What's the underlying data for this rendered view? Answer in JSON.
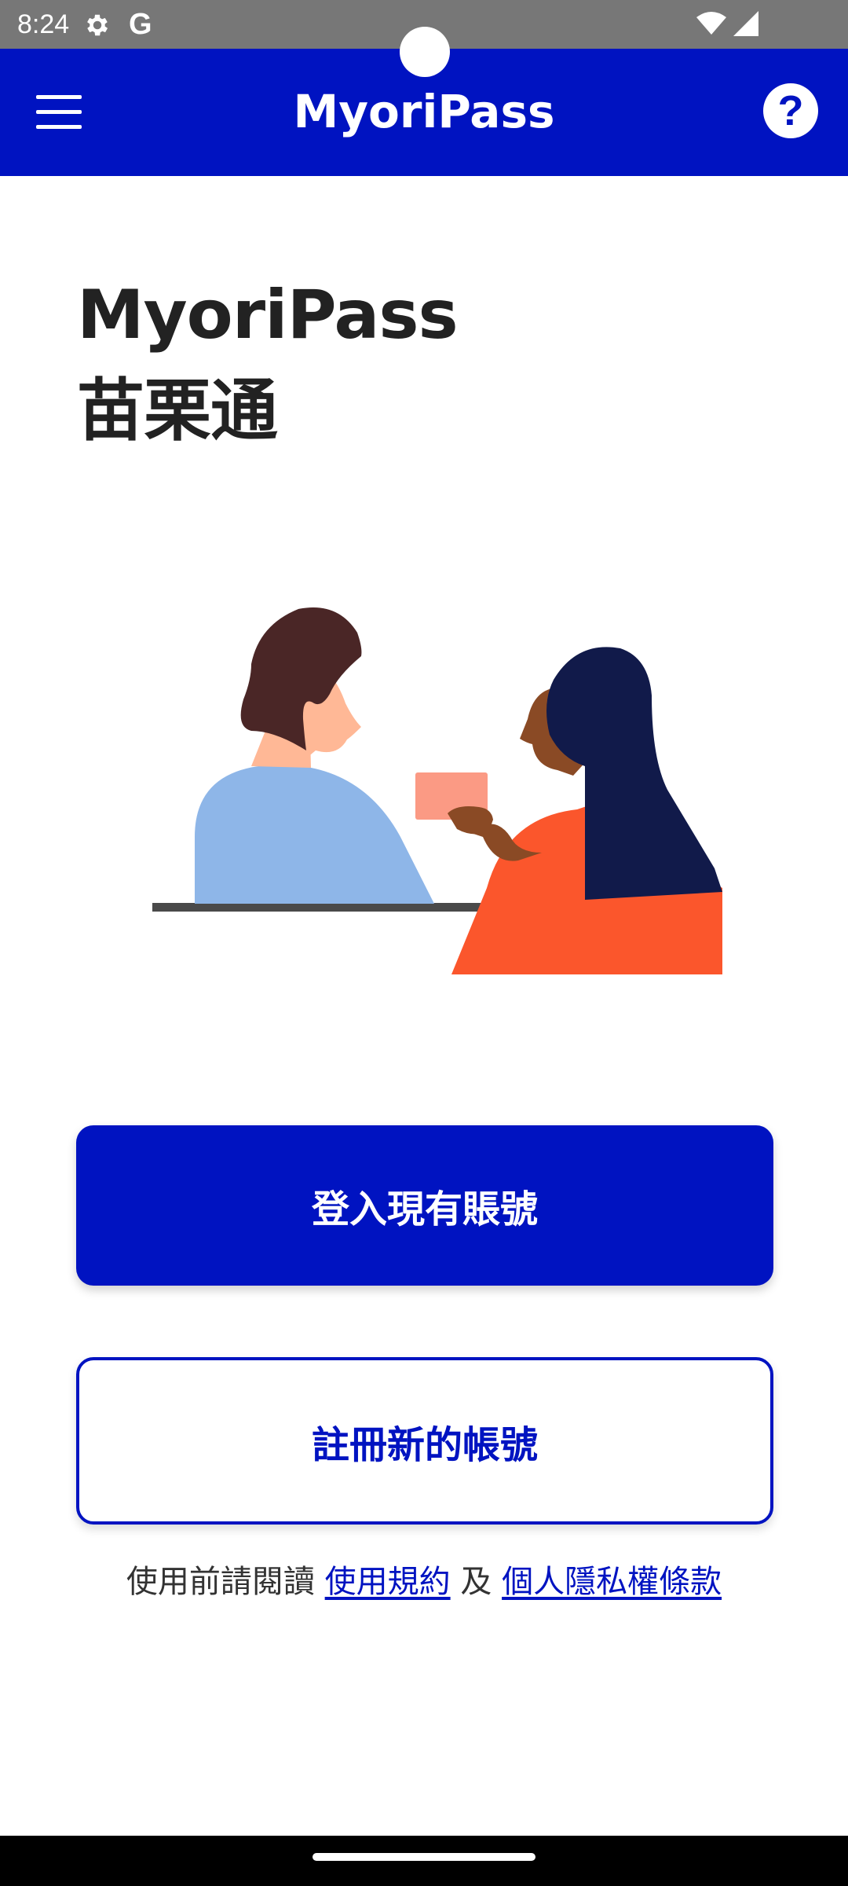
{
  "status_bar": {
    "time": "8:24",
    "icons": [
      "gear-icon",
      "google-icon",
      "wifi-icon",
      "signal-icon"
    ],
    "google_glyph": "G"
  },
  "app_bar": {
    "title": "MyoriPass",
    "menu_icon": "menu-icon",
    "help_label": "?"
  },
  "hero": {
    "title_line1": "MyoriPass",
    "title_line2": "苗栗通"
  },
  "actions": {
    "login_label": "登入現有賬號",
    "register_label": "註冊新的帳號"
  },
  "terms": {
    "prefix": "使用前請閱讀 ",
    "terms_link": "使用規約",
    "connector": " 及 ",
    "privacy_link": "個人隱私權條款"
  },
  "colors": {
    "primary": "#0013c1",
    "status_bar": "#777777",
    "text_dark": "#222222"
  }
}
